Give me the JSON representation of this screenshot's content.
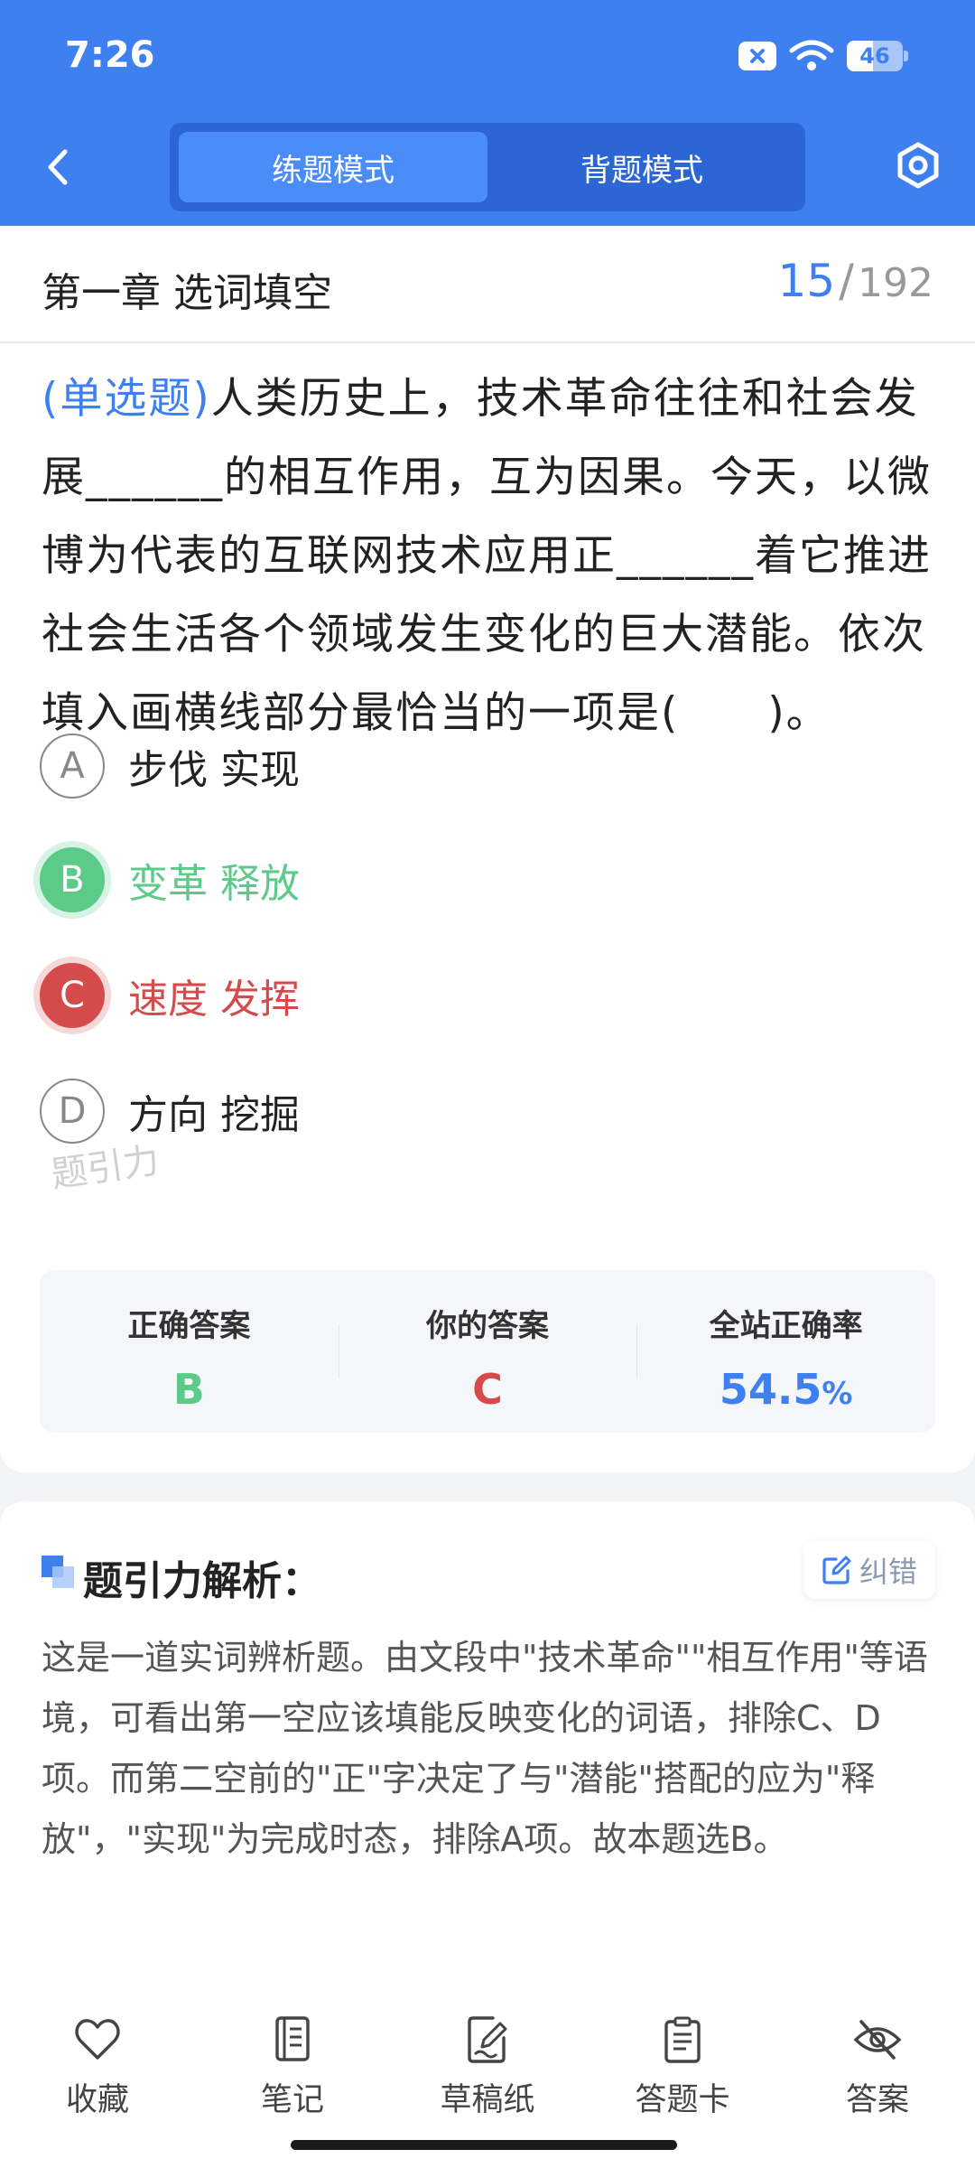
{
  "status_bar": {
    "time": "7:26",
    "battery": "46"
  },
  "header": {
    "tabs": [
      {
        "label": "练题模式",
        "active": true
      },
      {
        "label": "背题模式",
        "active": false
      }
    ]
  },
  "chapter": {
    "title": "第一章 选词填空",
    "current": "15",
    "separator": "/",
    "total": "192"
  },
  "question": {
    "type": "(单选题)",
    "text": "人类历史上，技术革命往往和社会发展______的相互作用，互为因果。今天，以微博为代表的互联网技术应用正______着它推进社会生活各个领域发生变化的巨大潜能。依次填入画横线部分最恰当的一项是(　　)。"
  },
  "options": [
    {
      "letter": "A",
      "text": "步伐 实现",
      "state": "normal"
    },
    {
      "letter": "B",
      "text": "变革 释放",
      "state": "correct"
    },
    {
      "letter": "C",
      "text": "速度 发挥",
      "state": "wrong"
    },
    {
      "letter": "D",
      "text": "方向 挖掘",
      "state": "normal"
    }
  ],
  "watermark": "题引力",
  "answer_summary": {
    "correct_label": "正确答案",
    "correct_value": "B",
    "yours_label": "你的答案",
    "yours_value": "C",
    "rate_label": "全站正确率",
    "rate_value": "54.5",
    "rate_unit": "%"
  },
  "analysis": {
    "title": "题引力解析：",
    "fix_label": "纠错",
    "text": "这是一道实词辨析题。由文段中\"技术革命\"\"相互作用\"等语境，可看出第一空应该填能反映变化的词语，排除C、D项。而第二空前的\"正\"字决定了与\"潜能\"搭配的应为\"释放\"，\"实现\"为完成时态，排除A项。故本题选B。"
  },
  "bottom_tabs": [
    {
      "label": "收藏",
      "icon": "heart-icon"
    },
    {
      "label": "笔记",
      "icon": "notebook-icon"
    },
    {
      "label": "草稿纸",
      "icon": "draft-pen-icon"
    },
    {
      "label": "答题卡",
      "icon": "clipboard-icon"
    },
    {
      "label": "答案",
      "icon": "eye-off-icon"
    }
  ],
  "colors": {
    "primary": "#3f80f0",
    "correct": "#5ccb8a",
    "wrong": "#d54a4a"
  }
}
